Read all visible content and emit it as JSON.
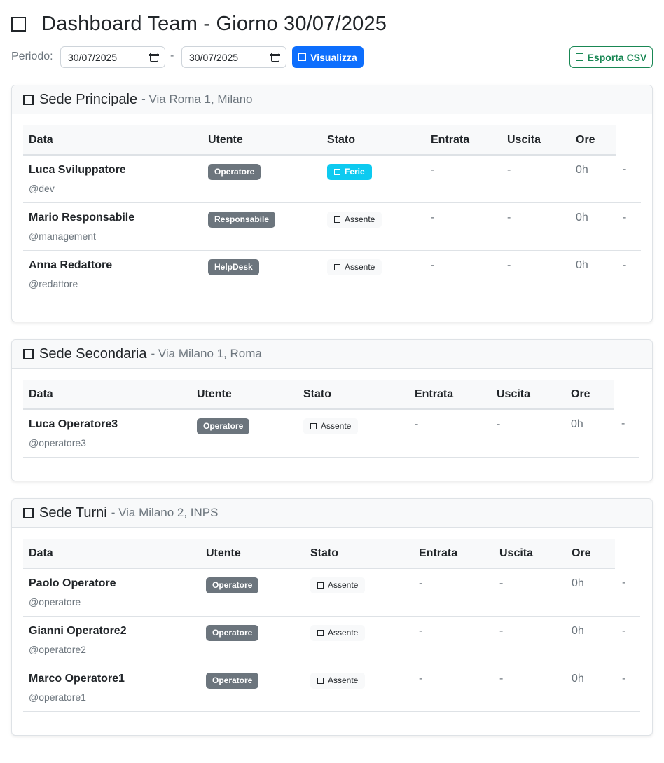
{
  "header": {
    "title": "Dashboard Team - Giorno 30/07/2025"
  },
  "filters": {
    "period_label": "Periodo:",
    "date_from": "30/07/2025",
    "separator": "-",
    "date_to": "30/07/2025",
    "view_button": "Visualizza",
    "export_button": "Esporta CSV"
  },
  "columns": [
    "Data",
    "Utente",
    "Stato",
    "Entrata",
    "Uscita",
    "Ore"
  ],
  "sites": [
    {
      "name": "Sede Principale",
      "location": "- Via Roma 1, Milano",
      "rows": [
        {
          "name": "Luca Sviluppatore",
          "handle": "@dev",
          "role": "Operatore",
          "status": "Ferie",
          "status_type": "ferie",
          "entrata": "-",
          "uscita": "-",
          "ore": "0h",
          "extra": "-"
        },
        {
          "name": "Mario Responsabile",
          "handle": "@management",
          "role": "Responsabile",
          "status": "Assente",
          "status_type": "assente",
          "entrata": "-",
          "uscita": "-",
          "ore": "0h",
          "extra": "-"
        },
        {
          "name": "Anna Redattore",
          "handle": "@redattore",
          "role": "HelpDesk",
          "status": "Assente",
          "status_type": "assente",
          "entrata": "-",
          "uscita": "-",
          "ore": "0h",
          "extra": "-"
        }
      ]
    },
    {
      "name": "Sede Secondaria",
      "location": "- Via Milano 1, Roma",
      "rows": [
        {
          "name": "Luca Operatore3",
          "handle": "@operatore3",
          "role": "Operatore",
          "status": "Assente",
          "status_type": "assente",
          "entrata": "-",
          "uscita": "-",
          "ore": "0h",
          "extra": "-"
        }
      ]
    },
    {
      "name": "Sede Turni",
      "location": "- Via Milano 2, INPS",
      "rows": [
        {
          "name": "Paolo Operatore",
          "handle": "@operatore",
          "role": "Operatore",
          "status": "Assente",
          "status_type": "assente",
          "entrata": "-",
          "uscita": "-",
          "ore": "0h",
          "extra": "-"
        },
        {
          "name": "Gianni Operatore2",
          "handle": "@operatore2",
          "role": "Operatore",
          "status": "Assente",
          "status_type": "assente",
          "entrata": "-",
          "uscita": "-",
          "ore": "0h",
          "extra": "-"
        },
        {
          "name": "Marco Operatore1",
          "handle": "@operatore1",
          "role": "Operatore",
          "status": "Assente",
          "status_type": "assente",
          "entrata": "-",
          "uscita": "-",
          "ore": "0h",
          "extra": "-"
        }
      ]
    }
  ],
  "colors": {
    "primary": "#0d6efd",
    "success": "#198754",
    "secondary": "#6c757d",
    "info": "#0dcaf0"
  }
}
